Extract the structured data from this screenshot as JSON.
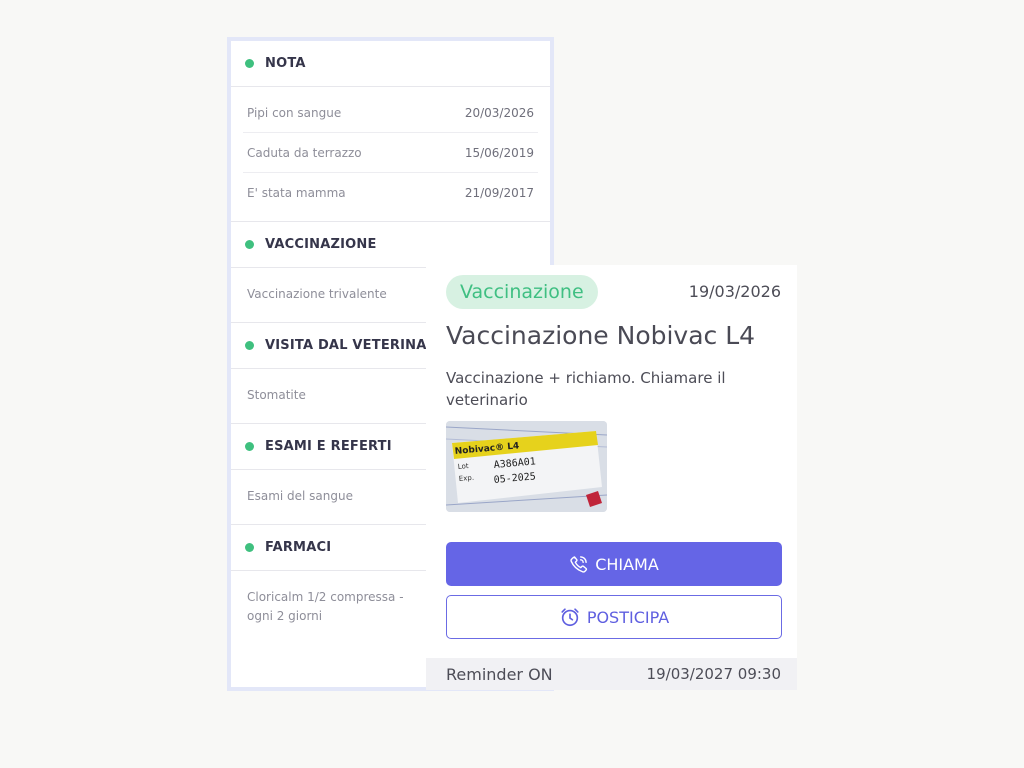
{
  "sections": {
    "nota": {
      "title": "NOTA",
      "items": [
        {
          "label": "Pipi con sangue",
          "date": "20/03/2026"
        },
        {
          "label": "Caduta da terrazzo",
          "date": "15/06/2019"
        },
        {
          "label": "E' stata mamma",
          "date": "21/09/2017"
        }
      ]
    },
    "vaccinazione": {
      "title": "VACCINAZIONE",
      "item": "Vaccinazione trivalente"
    },
    "visita": {
      "title": "VISITA DAL VETERINARIO",
      "item": "Stomatite"
    },
    "esami": {
      "title": "ESAMI E REFERTI",
      "item": "Esami del sangue"
    },
    "farmaci": {
      "title": "FARMACI",
      "item": "Cloricalm 1/2 compressa - ogni 2 giorni"
    }
  },
  "detail": {
    "badge": "Vaccinazione",
    "date": "19/03/2026",
    "title": "Vaccinazione Nobivac L4",
    "description": "Vaccinazione + richiamo. Chiamare il veterinario",
    "photo": {
      "brand": "Nobivac® L4",
      "lot_label": "Lot",
      "lot_value": "A386A01",
      "exp_label": "Exp.",
      "exp_value": "05-2025"
    },
    "call_label": "CHIAMA",
    "snooze_label": "POSTICIPA",
    "reminder_label": "Reminder ON",
    "reminder_date": "19/03/2027 09:30"
  },
  "colors": {
    "accent": "#6565e6",
    "status_dot": "#3fc07f",
    "badge_bg": "#d7f1e2",
    "badge_text": "#3fbf82"
  },
  "icons": {
    "call": "phone-icon",
    "snooze": "alarm-clock-icon",
    "section_marker": "status-dot-icon"
  }
}
